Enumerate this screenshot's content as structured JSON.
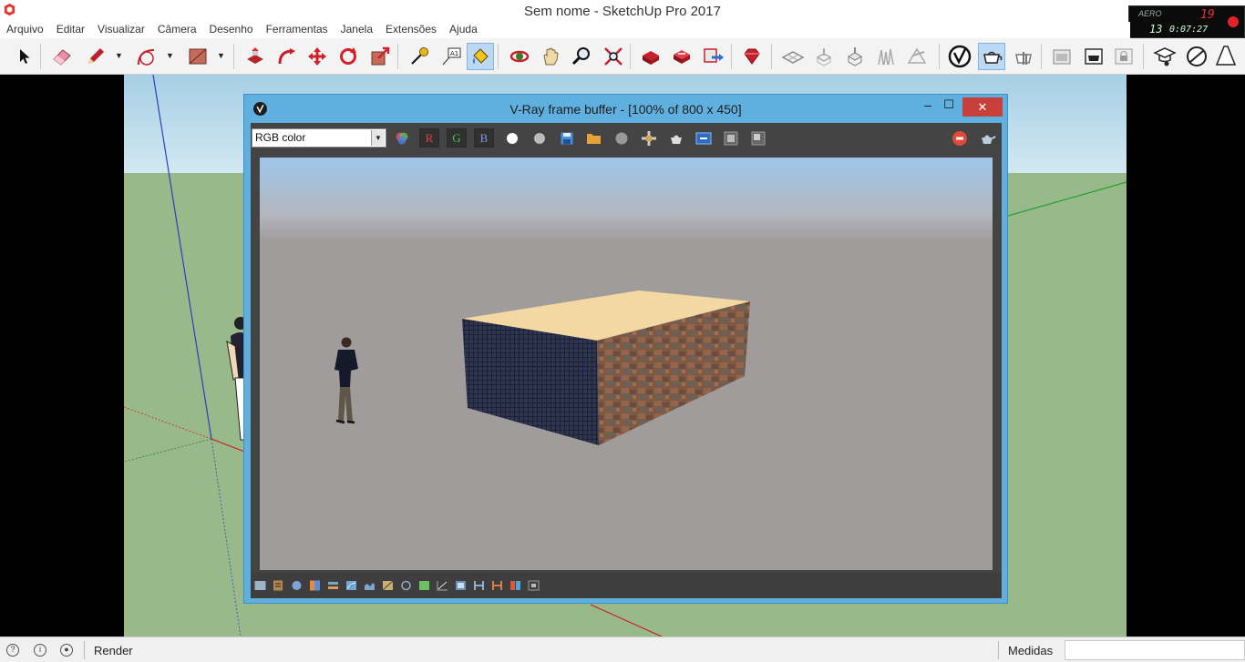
{
  "app": {
    "title": "Sem nome - SketchUp Pro 2017",
    "logo_icon": "sketchup-logo-icon"
  },
  "recorder": {
    "aero_label": "AERO",
    "count_top": "19",
    "count_bottom": "13",
    "time": "0:07:27"
  },
  "menu": [
    "Arquivo",
    "Editar",
    "Visualizar",
    "Câmera",
    "Desenho",
    "Ferramentas",
    "Janela",
    "Extensões",
    "Ajuda"
  ],
  "toolbar": {
    "tools": [
      {
        "name": "select-icon"
      },
      {
        "name": "eraser-icon"
      },
      {
        "name": "pencil-icon"
      },
      {
        "name": "arc-icon"
      },
      {
        "name": "rectangle-icon"
      },
      {
        "name": "push-pull-icon"
      },
      {
        "name": "follow-me-icon"
      },
      {
        "name": "move-icon"
      },
      {
        "name": "rotate-icon"
      },
      {
        "name": "scale-icon"
      },
      {
        "name": "tape-measure-icon"
      },
      {
        "name": "text-icon"
      },
      {
        "name": "paint-bucket-icon"
      },
      {
        "name": "orbit-icon"
      },
      {
        "name": "pan-icon"
      },
      {
        "name": "zoom-icon"
      },
      {
        "name": "zoom-extents-icon"
      },
      {
        "name": "warehouse-icon"
      },
      {
        "name": "extension-warehouse-icon"
      },
      {
        "name": "send-to-layout-icon"
      },
      {
        "name": "ruby-icon"
      },
      {
        "name": "sandbox-icon"
      },
      {
        "name": "vray-icon"
      },
      {
        "name": "vray-render-icon"
      },
      {
        "name": "vray-interactive-icon"
      }
    ],
    "active_tool": "paint-bucket-icon"
  },
  "vfb": {
    "title": "V-Ray frame buffer - [100% of 800 x 450]",
    "channel_select": "RGB color",
    "channels": [
      "R",
      "G",
      "B"
    ],
    "minimize": "–",
    "maximize": "☐",
    "close": "✕"
  },
  "status": {
    "message": "Render",
    "measure_label": "Medidas",
    "measure_value": ""
  },
  "colors": {
    "vfb_frame": "#5fb0df",
    "close_button": "#c8403a",
    "sky": "#a6cfe5",
    "ground": "#98b989",
    "render_background": "#a09c9c",
    "box_top": "#f3d8a3"
  }
}
